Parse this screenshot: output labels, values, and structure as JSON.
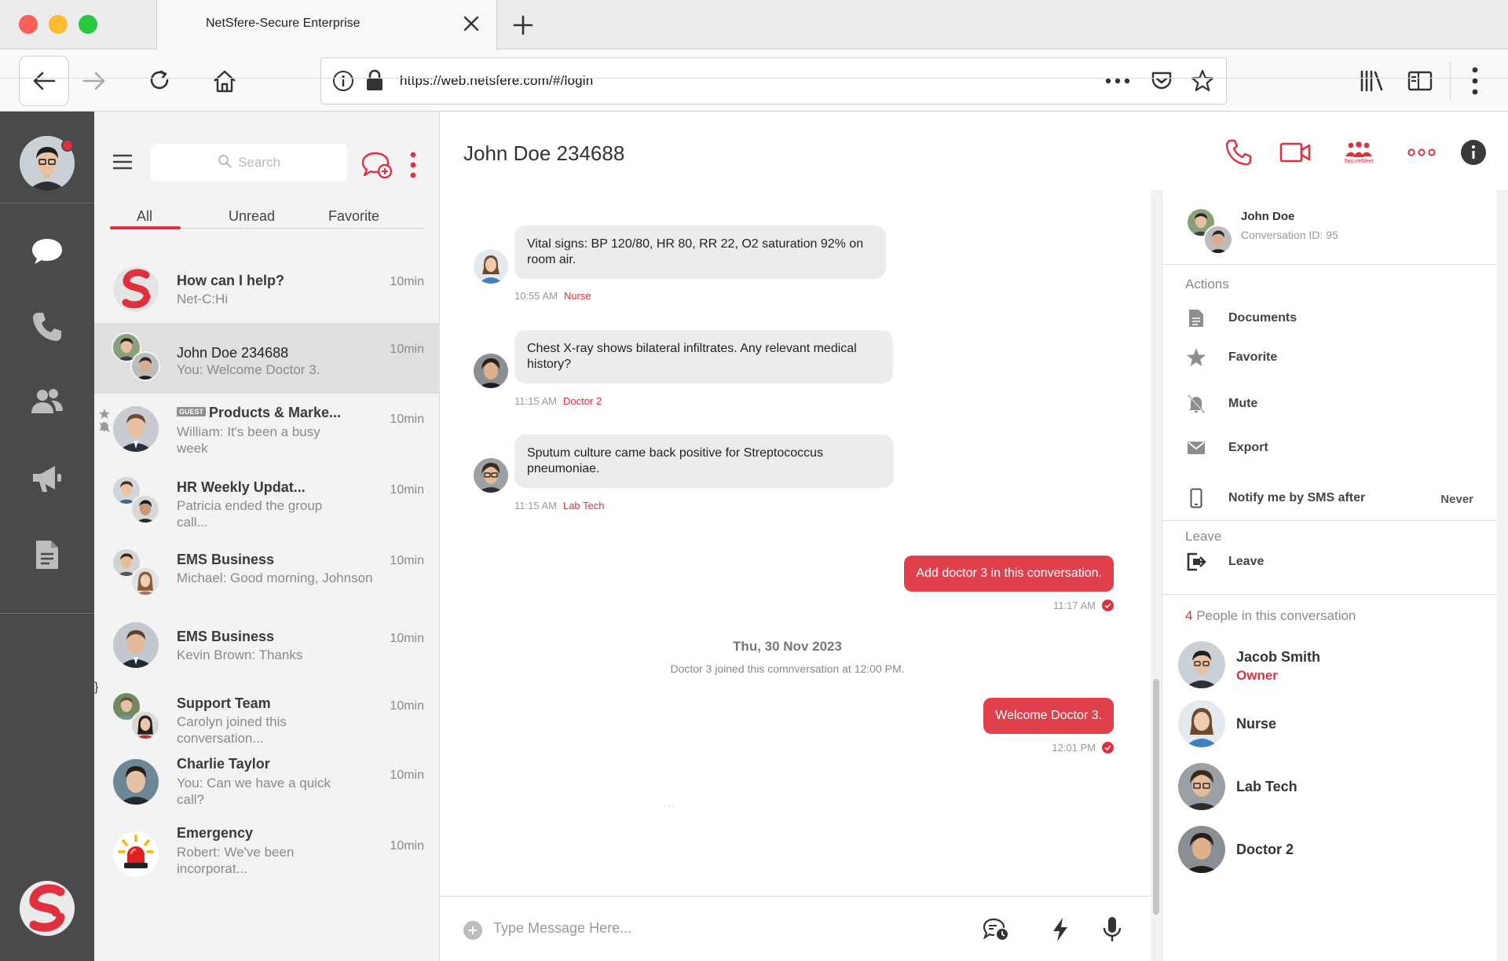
{
  "browser": {
    "tab_title": "NetSfere-Secure Enterprise",
    "url": "https://web.netsfere.com/#/login"
  },
  "list": {
    "search_placeholder": "Search",
    "tabs": [
      "All",
      "Unread",
      "Favorite"
    ],
    "conversations": [
      {
        "name": "How can I help?",
        "preview": "Net-C:Hi",
        "time": "10min"
      },
      {
        "name": "John Doe 234688",
        "preview": "You: Welcome Doctor 3.",
        "time": "10min"
      },
      {
        "name": "Products & Marke...",
        "guest": "GUEST",
        "preview": "William: It's been a busy week",
        "time": "10min"
      },
      {
        "name": "HR Weekly Updat...",
        "preview": "Patricia ended the group call...",
        "time": "10min"
      },
      {
        "name": "EMS Business",
        "preview": "Michael: Good morning, Johnson",
        "time": "10min"
      },
      {
        "name": "EMS Business",
        "preview": "Kevin Brown: Thanks",
        "time": "10min"
      },
      {
        "name": "Support Team",
        "preview": "Carolyn joined this conversation...",
        "time": "10min"
      },
      {
        "name": "Charlie Taylor",
        "preview": "You: Can we have a quick call?",
        "time": "10min"
      },
      {
        "name": "Emergency",
        "preview": "Robert: We've been incorporat...",
        "time": "10min"
      }
    ]
  },
  "chat": {
    "title": "John Doe 234688",
    "securemeet_label": "SecureMeet",
    "messages": [
      {
        "text": "Vital signs: BP 120/80, HR 80, RR 22, O2 saturation 92% on room air.",
        "time": "10:55 AM",
        "sender": "Nurse"
      },
      {
        "text": "Chest X-ray shows bilateral infiltrates. Any relevant medical history?",
        "time": "11:15 AM",
        "sender": "Doctor 2"
      },
      {
        "text": "Sputum culture came back positive for Streptococcus pneumoniae.",
        "time": "11:15 AM",
        "sender": "Lab Tech"
      },
      {
        "text": "Add doctor 3 in this conversation.",
        "time": "11:17 AM"
      },
      {
        "text": "Welcome Doctor 3.",
        "time": "12:01 PM"
      }
    ],
    "date_separator": "Thu, 30 Nov 2023",
    "system_message": "Doctor 3 joined this comnversation at 12:00 PM.",
    "typing": "...",
    "composer_placeholder": "Type Message Here..."
  },
  "info": {
    "name": "John Doe",
    "conversation_id": "Conversation ID: 95",
    "actions_title": "Actions",
    "actions": [
      {
        "label": "Documents",
        "icon": "document-icon"
      },
      {
        "label": "Favorite",
        "icon": "star-icon"
      },
      {
        "label": "Mute",
        "icon": "bell-off-icon"
      },
      {
        "label": "Export",
        "icon": "envelope-icon"
      },
      {
        "label": "Notify me by SMS after",
        "icon": "phone-device-icon",
        "value": "Never"
      }
    ],
    "leave_title": "Leave",
    "leave_label": "Leave",
    "people_count": "4",
    "people_title": "People in this conversation",
    "people": [
      {
        "name": "Jacob Smith",
        "role": "Owner"
      },
      {
        "name": "Nurse"
      },
      {
        "name": "Lab Tech"
      },
      {
        "name": "Doctor 2"
      }
    ]
  },
  "colors": {
    "accent": "#e0303f",
    "rail": "#4a4a4a",
    "list_bg": "#f3f3f3",
    "bubble_in": "#ececec",
    "bubble_out": "#e0404c"
  }
}
